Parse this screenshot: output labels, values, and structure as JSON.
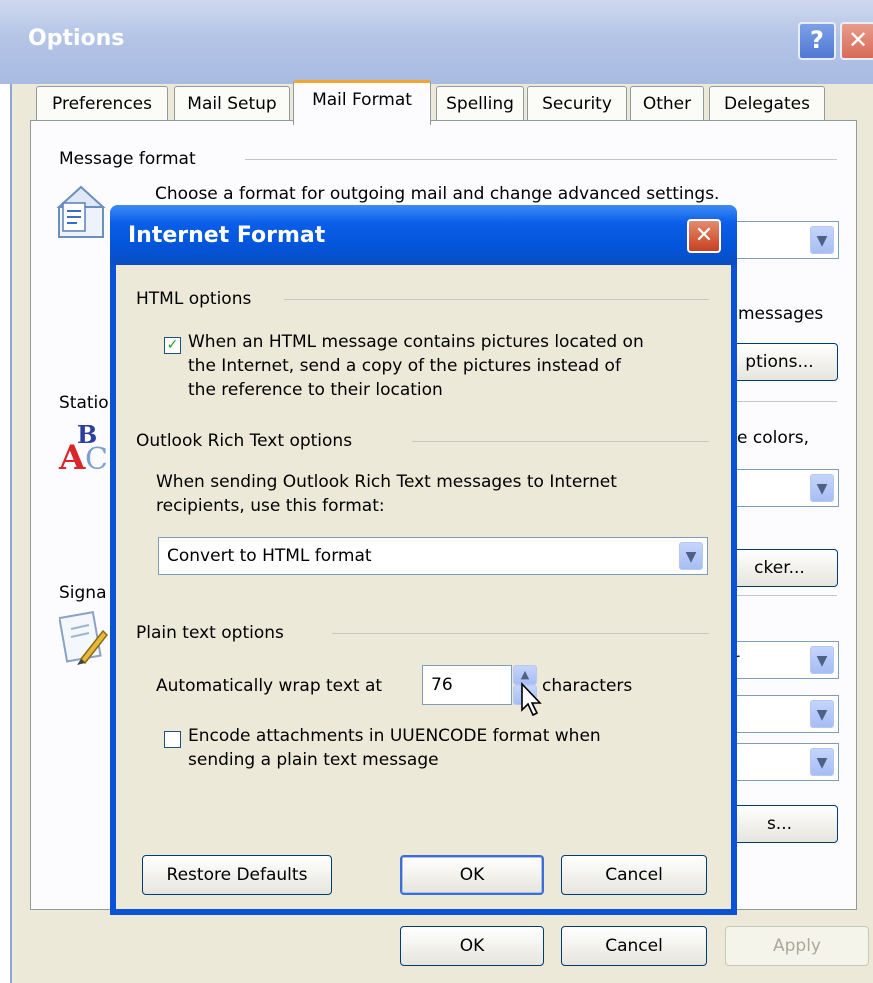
{
  "window": {
    "title": "Options",
    "help_glyph": "?",
    "close_glyph": "✕"
  },
  "tabs": [
    {
      "label": "Preferences"
    },
    {
      "label": "Mail Setup"
    },
    {
      "label": "Mail Format",
      "active": true
    },
    {
      "label": "Spelling"
    },
    {
      "label": "Security"
    },
    {
      "label": "Other"
    },
    {
      "label": "Delegates"
    }
  ],
  "mail_format_tab": {
    "message_format_heading": "Message format",
    "message_format_desc": "Choose a format for outgoing mail and change advanced settings.",
    "messages_fragment": "messages",
    "options_button_fragment": "ptions...",
    "stationery_heading_fragment": "Statio",
    "colors_fragment": "e colors,",
    "picker_button_fragment": "cker...",
    "signatures_heading_fragment": "Signa",
    "combo_value_fragment": "er",
    "signatures_button_fragment": "s..."
  },
  "footer": {
    "ok_label": "OK",
    "cancel_label": "Cancel",
    "apply_label": "Apply"
  },
  "dialog": {
    "title": "Internet Format",
    "close_glyph": "✕",
    "html_options_heading": "HTML options",
    "html_pictures_checkbox": {
      "checked": true,
      "line1": "When an HTML message contains pictures located on",
      "line2": "the Internet, send a copy of the pictures instead of",
      "line3": "the reference to their location"
    },
    "rtf_heading": "Outlook Rich Text options",
    "rtf_desc_line1": "When sending Outlook Rich Text messages to Internet",
    "rtf_desc_line2": "recipients, use this format:",
    "rtf_format_value": "Convert to HTML format",
    "plain_heading": "Plain text options",
    "wrap_label": "Automatically wrap text at",
    "wrap_value": "76",
    "wrap_unit": "characters",
    "uuencode_checkbox": {
      "checked": false,
      "line1": "Encode attachments in UUENCODE format when",
      "line2": "sending a plain text message"
    },
    "restore_defaults_label": "Restore Defaults",
    "ok_label": "OK",
    "cancel_label": "Cancel"
  },
  "colors": {
    "xp_blue": "#0a53d6",
    "window_face": "#ece9d8",
    "tab_highlight": "#f2a530",
    "check_green": "#21a121"
  }
}
